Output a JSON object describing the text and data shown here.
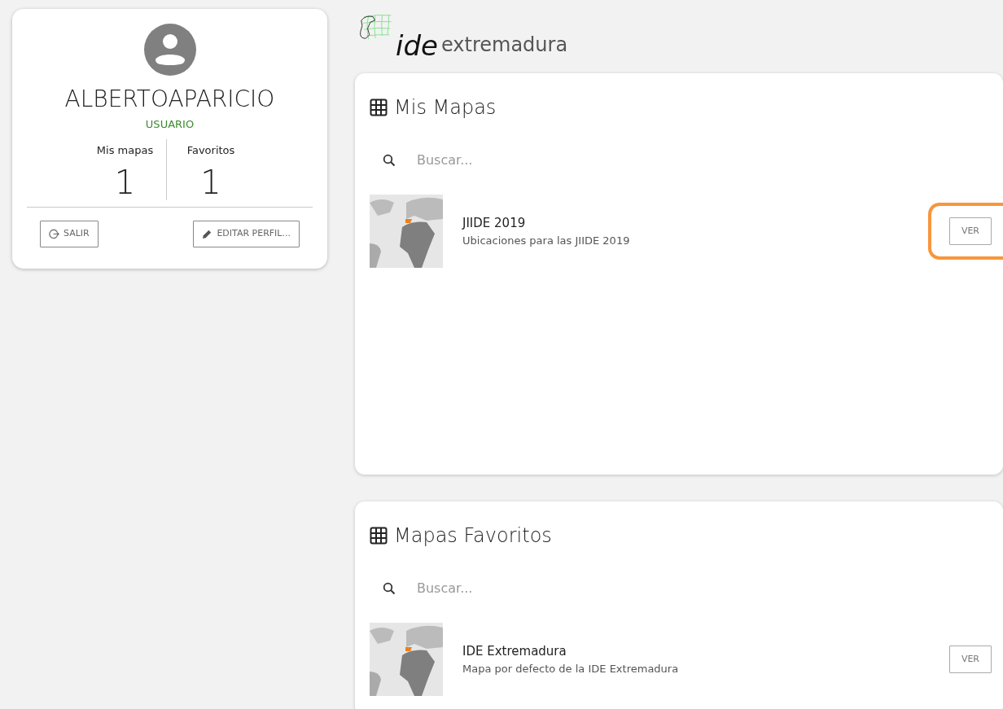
{
  "profile": {
    "username": "ALBERTOAPARICIO",
    "role": "USUARIO",
    "stats": [
      {
        "label": "Mis mapas",
        "value": "1"
      },
      {
        "label": "Favoritos",
        "value": "1"
      }
    ],
    "buttons": [
      {
        "kind": "logout",
        "label": "SALIR"
      },
      {
        "kind": "edit",
        "label": "EDITAR PERFIL..."
      }
    ]
  },
  "logo": {
    "mark": "ide",
    "name": "extremadura"
  },
  "sections": [
    {
      "title": "Mis Mapas",
      "search": {
        "placeholder": "Buscar..."
      },
      "maps": [
        {
          "title": "JIIDE 2019",
          "description": "Ubicaciones para las JIIDE 2019",
          "button": "VER",
          "highlighted": true
        }
      ]
    },
    {
      "title": "Mapas Favoritos",
      "search": {
        "placeholder": "Buscar..."
      },
      "maps": [
        {
          "title": "IDE Extremadura",
          "description": "Mapa por defecto de la IDE Extremadura",
          "button": "VER",
          "highlighted": false
        }
      ]
    }
  ]
}
